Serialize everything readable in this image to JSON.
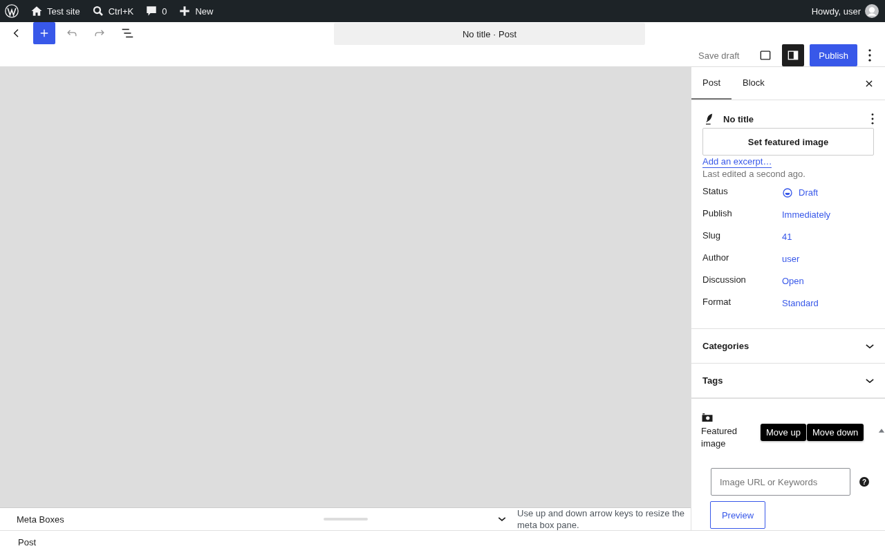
{
  "admin_bar": {
    "site": "Test site",
    "search": "Ctrl+K",
    "comments": "0",
    "new": "New",
    "greeting": "Howdy, user"
  },
  "toolbar": {
    "undo": {
      "disabled": true
    },
    "redo": {
      "disabled": true
    },
    "title": "No title · Post",
    "save_draft": "Save draft",
    "settings": {
      "pressed": true
    },
    "publish": "Publish"
  },
  "sidebar": {
    "tabs": [
      {
        "label": "Post",
        "selected": true
      },
      {
        "label": "Block",
        "selected": false
      }
    ],
    "post": {
      "title": "No title",
      "featured_button": "Set featured image",
      "excerpt_link": "Add an excerpt…",
      "last_edited": "Last edited a second ago."
    },
    "fields": [
      {
        "label": "Status",
        "value": "Draft",
        "kind": "status"
      },
      {
        "label": "Publish",
        "value": "Immediately",
        "kind": "link"
      },
      {
        "label": "Slug",
        "value": "41",
        "kind": "link"
      },
      {
        "label": "Author",
        "value": "user",
        "kind": "link"
      },
      {
        "label": "Discussion",
        "value": "Open",
        "kind": "link"
      },
      {
        "label": "Format",
        "value": "Standard",
        "kind": "link"
      }
    ],
    "panels": [
      {
        "title": "Categories",
        "expanded": false
      },
      {
        "title": "Tags",
        "expanded": false
      }
    ],
    "metabox": {
      "title": "Featured image",
      "tooltips": [
        "Move up",
        "Move down"
      ],
      "placeholder": "Image URL or Keywords",
      "help": "?",
      "preview": "Preview"
    }
  },
  "meta_boxes": {
    "label": "Meta Boxes",
    "hint": "Use up and down arrow keys to resize the meta box pane."
  },
  "footer": {
    "breadcrumb": "Post"
  }
}
